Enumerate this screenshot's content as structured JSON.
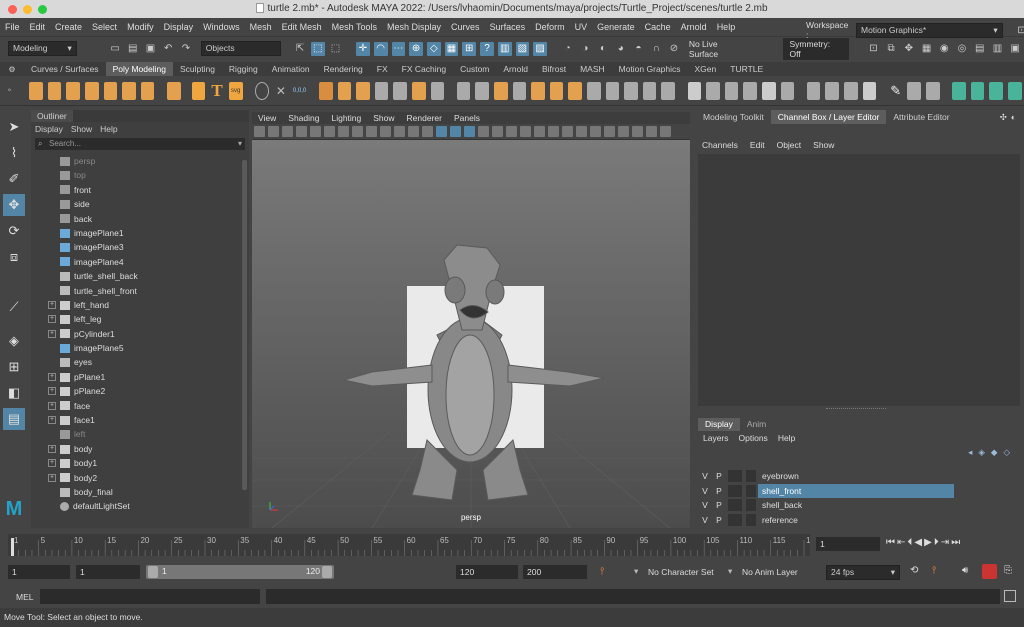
{
  "window": {
    "title": "turtle 2.mb* - Autodesk MAYA 2022: /Users/lvhaomin/Documents/maya/projects/Turtle_Project/scenes/turtle 2.mb"
  },
  "menubar": {
    "items": [
      "File",
      "Edit",
      "Create",
      "Select",
      "Modify",
      "Display",
      "Windows",
      "Mesh",
      "Edit Mesh",
      "Mesh Tools",
      "Mesh Display",
      "Curves",
      "Surfaces",
      "Deform",
      "UV",
      "Generate",
      "Cache",
      "Arnold",
      "Help"
    ],
    "workspace_label": "Workspace :",
    "workspace_value": "Motion Graphics*"
  },
  "statusline": {
    "menuset": "Modeling",
    "selection_mode": "Objects",
    "live_surface": "No Live Surface",
    "symmetry": "Symmetry: Off"
  },
  "shelf": {
    "tabs": [
      "Curves / Surfaces",
      "Poly Modeling",
      "Sculpting",
      "Rigging",
      "Animation",
      "Rendering",
      "FX",
      "FX Caching",
      "Custom",
      "Arnold",
      "Bifrost",
      "MASH",
      "Motion Graphics",
      "XGen",
      "TURTLE"
    ],
    "active_tab": "Poly Modeling",
    "svg_label": "svg",
    "coord_label": "0,0,0"
  },
  "outliner": {
    "title": "Outliner",
    "menu": [
      "Display",
      "Show",
      "Help"
    ],
    "search_placeholder": "Search...",
    "items": [
      {
        "name": "persp",
        "kind": "camera",
        "dim": true,
        "expandable": false
      },
      {
        "name": "top",
        "kind": "camera",
        "dim": true,
        "expandable": false
      },
      {
        "name": "front",
        "kind": "camera",
        "dim": false,
        "expandable": false
      },
      {
        "name": "side",
        "kind": "camera",
        "dim": false,
        "expandable": false
      },
      {
        "name": "back",
        "kind": "camera",
        "dim": false,
        "expandable": false
      },
      {
        "name": "imagePlane1",
        "kind": "imageplane",
        "dim": false,
        "expandable": false
      },
      {
        "name": "imagePlane3",
        "kind": "imageplane",
        "dim": false,
        "expandable": false
      },
      {
        "name": "imagePlane4",
        "kind": "imageplane",
        "dim": false,
        "expandable": false
      },
      {
        "name": "turtle_shell_back",
        "kind": "mesh",
        "dim": false,
        "expandable": false
      },
      {
        "name": "turtle_shell_front",
        "kind": "mesh",
        "dim": false,
        "expandable": false
      },
      {
        "name": "left_hand",
        "kind": "transform",
        "dim": false,
        "expandable": true
      },
      {
        "name": "left_leg",
        "kind": "transform",
        "dim": false,
        "expandable": true
      },
      {
        "name": "pCylinder1",
        "kind": "transform",
        "dim": false,
        "expandable": true
      },
      {
        "name": "imagePlane5",
        "kind": "imageplane",
        "dim": false,
        "expandable": false
      },
      {
        "name": "eyes",
        "kind": "mesh",
        "dim": false,
        "expandable": false
      },
      {
        "name": "pPlane1",
        "kind": "transform",
        "dim": false,
        "expandable": true
      },
      {
        "name": "pPlane2",
        "kind": "transform",
        "dim": false,
        "expandable": true
      },
      {
        "name": "face",
        "kind": "transform",
        "dim": false,
        "expandable": true
      },
      {
        "name": "face1",
        "kind": "transform",
        "dim": false,
        "expandable": true
      },
      {
        "name": "left",
        "kind": "camera",
        "dim": true,
        "expandable": false
      },
      {
        "name": "body",
        "kind": "transform",
        "dim": false,
        "expandable": true
      },
      {
        "name": "body1",
        "kind": "transform",
        "dim": false,
        "expandable": true
      },
      {
        "name": "body2",
        "kind": "transform",
        "dim": false,
        "expandable": true
      },
      {
        "name": "body_final",
        "kind": "mesh",
        "dim": false,
        "expandable": false
      },
      {
        "name": "defaultLightSet",
        "kind": "set",
        "dim": false,
        "expandable": false
      }
    ]
  },
  "viewport": {
    "menu": [
      "View",
      "Shading",
      "Lighting",
      "Show",
      "Renderer",
      "Panels"
    ],
    "camera_label": "persp"
  },
  "right_panel": {
    "tabs": [
      "Modeling Toolkit",
      "Channel Box / Layer Editor",
      "Attribute Editor"
    ],
    "active_tab": "Channel Box / Layer Editor",
    "channel_menu": [
      "Channels",
      "Edit",
      "Object",
      "Show"
    ],
    "layer_tabs": [
      "Display",
      "Anim"
    ],
    "active_layer_tab": "Display",
    "layer_menu": [
      "Layers",
      "Options",
      "Help"
    ],
    "layers": [
      {
        "v": "V",
        "p": "P",
        "name": "eyebrown",
        "selected": false
      },
      {
        "v": "V",
        "p": "P",
        "name": "shell_front",
        "selected": true
      },
      {
        "v": "V",
        "p": "P",
        "name": "shell_back",
        "selected": false
      },
      {
        "v": "V",
        "p": "P",
        "name": "reference",
        "selected": false
      }
    ]
  },
  "timeslider": {
    "ticks": [
      "1",
      "5",
      "10",
      "15",
      "20",
      "25",
      "30",
      "35",
      "40",
      "45",
      "50",
      "55",
      "60",
      "65",
      "70",
      "75",
      "80",
      "85",
      "90",
      "95",
      "100",
      "105",
      "110",
      "115",
      "120"
    ],
    "current_frame": "1"
  },
  "rangeslider": {
    "start": "1",
    "playback_start": "1",
    "range_inner_start": "1",
    "range_inner_end": "120",
    "playback_end": "120",
    "end": "200",
    "character_set": "No Character Set",
    "anim_layer": "No Anim Layer",
    "fps": "24 fps"
  },
  "cmdline": {
    "label": "MEL"
  },
  "helpline": {
    "text": "Move Tool: Select an object to move."
  }
}
